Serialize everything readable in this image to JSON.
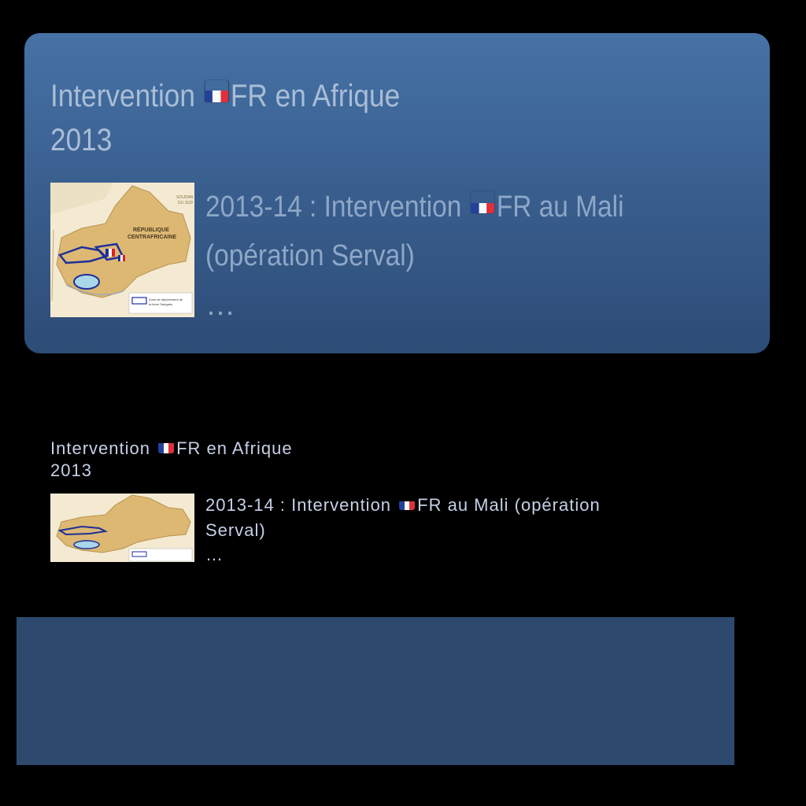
{
  "card": {
    "title_part1": "Intervention ",
    "title_part2": "FR en Afrique",
    "year": "2013",
    "entry_part1": "2013-14 : Intervention ",
    "entry_part2": "FR au Mali (opération Serval)",
    "more": "…",
    "map": {
      "label_country_1": "RÉPUBLIQUE",
      "label_country_2": "CENTRAFRICAINE",
      "label_neighbor_1": "SOUDAN",
      "label_neighbor_2": "DU SUD",
      "legend_1": "Zone de déploiement de",
      "legend_2": "la force Sangaris"
    }
  },
  "plain": {
    "title_part1": "Intervention ",
    "title_part2": "FR en Afrique",
    "year": "2013",
    "entry_part1": "2013-14 : Intervention ",
    "entry_part2": "FR au Mali (opération",
    "entry_part3": "Serval)",
    "more": "…"
  },
  "colors": {
    "card_top": "#4672a6",
    "card_bottom": "#2d4c76",
    "panel": "#2d4a6e",
    "flag_blue": "#23409a",
    "flag_red": "#e0303b"
  },
  "icons": {
    "flag": "flag-france-icon"
  }
}
